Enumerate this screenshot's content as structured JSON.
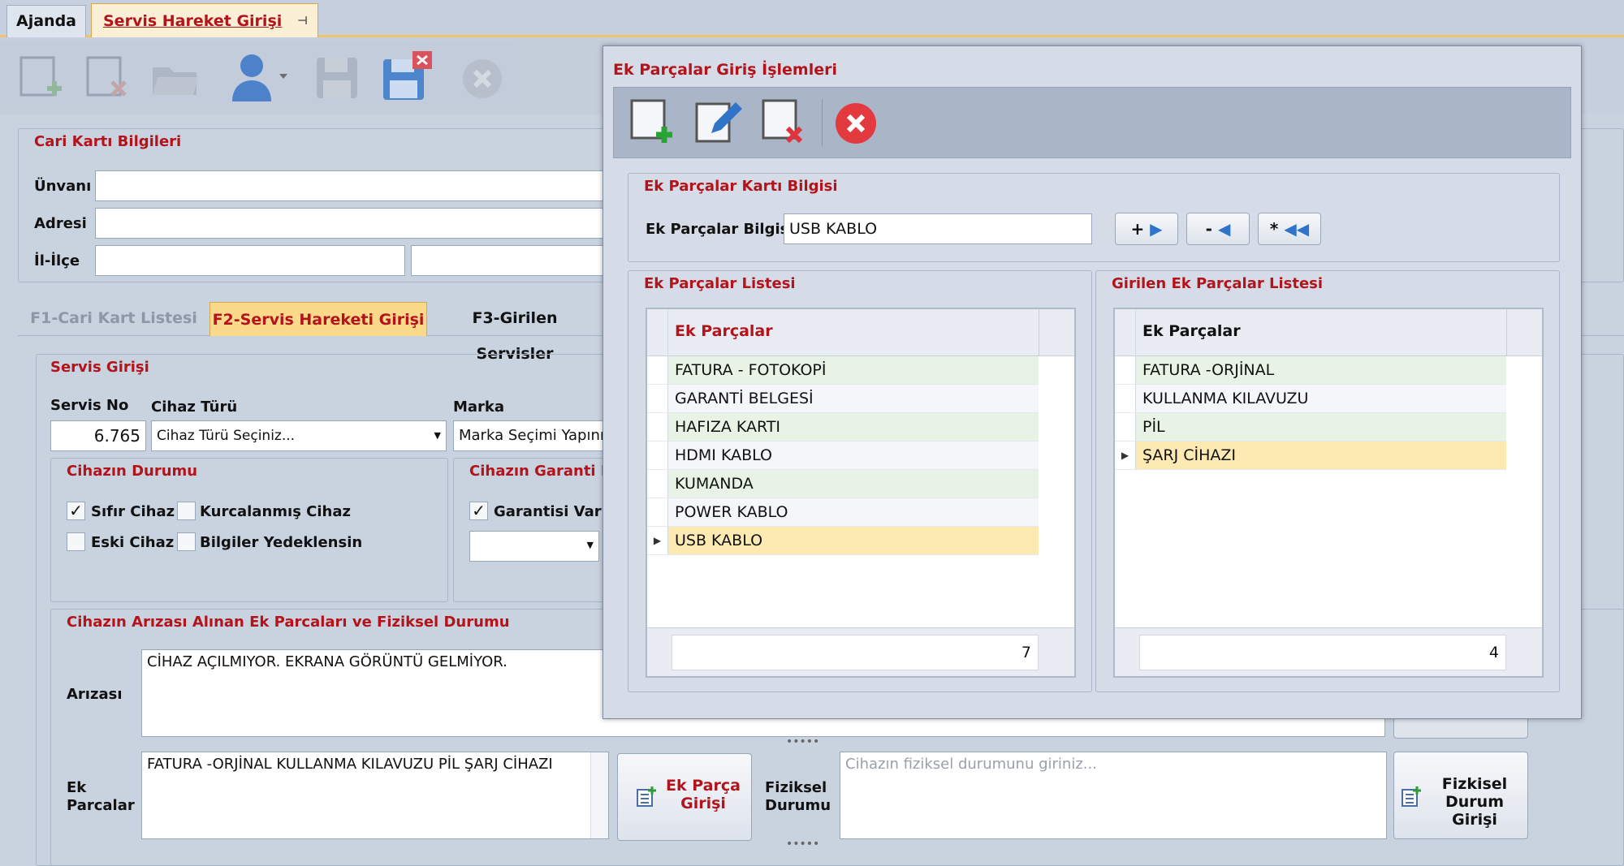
{
  "tabs": [
    {
      "label": "Ajanda"
    },
    {
      "label": "Servis Hareket Girişi",
      "pin": "⊣"
    }
  ],
  "cari": {
    "title": "Cari Kartı Bilgileri",
    "unvan": "Ünvanı",
    "adres": "Adresi",
    "ililce": "İl-İlçe"
  },
  "subtabs": [
    {
      "label": "F1-Cari Kart Listesi"
    },
    {
      "label": "F2-Servis Hareketi Girişi"
    },
    {
      "label": "F3-Girilen Servisler"
    }
  ],
  "servis": {
    "title": "Servis Girişi",
    "servis_no_label": "Servis No",
    "servis_no": "6.765",
    "cihaz_turu_label": "Cihaz Türü",
    "cihaz_turu": "Cihaz Türü Seçiniz...",
    "marka_label": "Marka",
    "marka": "Marka Seçimi Yapınız",
    "durum_title": "Cihazın Durumu",
    "sifir": "Sıfır Cihaz",
    "kurcalanmis": "Kurcalanmış Cihaz",
    "eski": "Eski Cihaz",
    "yedek": "Bilgiler Yedeklensin",
    "garanti_title": "Cihazın Garanti Durumu",
    "garanti_var": "Garantisi Var",
    "ariza_title": "Cihazın Arızası Alınan Ek Parcaları ve Fiziksel Durumu",
    "ariza_label": "Arızası",
    "ariza_text": "CİHAZ AÇILMIYOR. EKRANA GÖRÜNTÜ GELMİYOR.",
    "ek_label1": "Ek",
    "ek_label2": "Parcalar",
    "ek_text": "FATURA -ORJİNAL KULLANMA KILAVUZU PİL ŞARJ CİHAZI",
    "ek_btn1": "Ek Parça",
    "ek_btn2": "Girişi",
    "fiz_label1": "Fiziksel",
    "fiz_label2": "Durumu",
    "fiz_placeholder": "Cihazın fiziksel durumunu giriniz...",
    "fiz_btn1": "Fizkisel",
    "fiz_btn2": "Durum Girişi"
  },
  "dialog": {
    "title": "Ek Parçalar Giriş İşlemleri",
    "card_title": "Ek Parçalar Kartı Bilgisi",
    "field_label": "Ek Parçalar Bilgisi",
    "field_value": "USB KABLO",
    "btn_add": "+",
    "btn_remove": "-",
    "btn_all": "*",
    "left_title": "Ek Parçalar Listesi",
    "left_header": "Ek Parçalar",
    "left_rows": [
      "FATURA - FOTOKOPİ",
      "GARANTİ BELGESİ",
      "HAFIZA KARTI",
      "HDMI KABLO",
      "KUMANDA",
      "POWER KABLO",
      "USB KABLO"
    ],
    "left_count": "7",
    "right_title": "Girilen Ek Parçalar Listesi",
    "right_header": "Ek Parçalar",
    "right_rows": [
      "FATURA -ORJİNAL",
      "KULLANMA KILAVUZU",
      "PİL",
      "ŞARJ CİHAZI"
    ],
    "right_count": "4"
  },
  "colors": {
    "accent": "#b3131b",
    "selected_row": "#fde9b2",
    "alt_row": "#e8f3e6"
  }
}
